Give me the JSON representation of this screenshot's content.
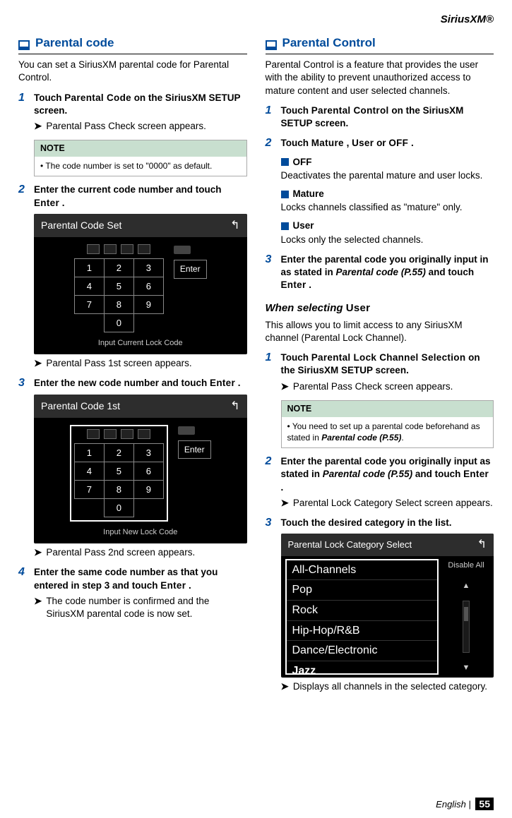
{
  "brand": "SiriusXM®",
  "footer": {
    "label": "English",
    "page": "55"
  },
  "left": {
    "heading": "Parental code",
    "lead": "You can set a SiriusXM parental code for Parental Control.",
    "step1": {
      "a": "Touch ",
      "btn": "Parental Code",
      "b": " on the SiriusXM SETUP screen."
    },
    "step1_sub": "Parental Pass Check screen appears.",
    "note1_head": "NOTE",
    "note1_body": "The code number is set to \"0000\" as default.",
    "step2": {
      "a": "Enter the current code number and touch ",
      "btn": "Enter",
      "b": " ."
    },
    "shot1": {
      "title": "Parental Code Set",
      "enter": "Enter",
      "caption": "Input Current Lock Code",
      "keys": [
        [
          "1",
          "2",
          "3"
        ],
        [
          "4",
          "5",
          "6"
        ],
        [
          "7",
          "8",
          "9"
        ],
        [
          "",
          "0",
          ""
        ]
      ]
    },
    "step2_sub": "Parental Pass 1st screen appears.",
    "step3": {
      "a": "Enter the new code number and touch ",
      "btn": "Enter",
      "b": " ."
    },
    "shot2": {
      "title": "Parental Code 1st",
      "enter": "Enter",
      "caption": "Input New Lock Code",
      "keys": [
        [
          "1",
          "2",
          "3"
        ],
        [
          "4",
          "5",
          "6"
        ],
        [
          "7",
          "8",
          "9"
        ],
        [
          "",
          "0",
          ""
        ]
      ]
    },
    "step3_sub": "Parental Pass 2nd screen appears.",
    "step4": {
      "a": "Enter the same code number as that you entered in step 3 and touch ",
      "btn": "Enter",
      "b": " ."
    },
    "step4_sub": "The code number is confirmed and the SiriusXM parental code is now set."
  },
  "right": {
    "heading": "Parental Control",
    "lead": "Parental Control is a feature that provides the user with the ability to prevent unauthorized access to mature content and user selected channels.",
    "step1": {
      "a": "Touch ",
      "btn": "Parental Control",
      "b": " on the SiriusXM SETUP screen."
    },
    "step2": {
      "a": "Touch ",
      "b1": "Mature",
      "c1": " , ",
      "b2": "User",
      "c2": " or ",
      "b3": "OFF",
      "c3": " ."
    },
    "opt_off": {
      "name": "OFF",
      "desc": "Deactivates the parental mature and user locks."
    },
    "opt_mature": {
      "name": "Mature",
      "desc": "Locks channels classified as \"mature\" only."
    },
    "opt_user": {
      "name": "User",
      "desc": "Locks only the selected channels."
    },
    "step3": {
      "a": "Enter the parental code you originally input in as stated in ",
      "ref": "Parental code (P.55)",
      "b": " and touch ",
      "btn": "Enter",
      "c": " ."
    },
    "subhead": {
      "a": "When selecting ",
      "btn": "User"
    },
    "sublead": "This allows you to limit access to any SiriusXM channel (Parental Lock Channel).",
    "ustep1": {
      "a": "Touch ",
      "btn": "Parental Lock Channel Selection",
      "b": " on the SiriusXM SETUP screen."
    },
    "ustep1_sub": "Parental Pass Check screen appears.",
    "note2_head": "NOTE",
    "note2_body_a": "You need to set up a parental code beforehand as stated in ",
    "note2_body_ref": "Parental code (P.55)",
    "note2_body_b": ".",
    "ustep2": {
      "a": "Enter the parental code you originally input as stated in ",
      "ref": "Parental code (P.55)",
      "b": " and touch ",
      "btn": "Enter",
      "c": " ."
    },
    "ustep2_sub": "Parental Lock Category Select screen appears.",
    "ustep3": "Touch the desired category in the list.",
    "catshot": {
      "title": "Parental Lock Category Select",
      "disable": "Disable All",
      "items": [
        "All-Channels",
        "Pop",
        "Rock",
        "Hip-Hop/R&B",
        "Dance/Electronic",
        "Jazz"
      ]
    },
    "ustep3_sub": "Displays all channels in the selected category."
  }
}
